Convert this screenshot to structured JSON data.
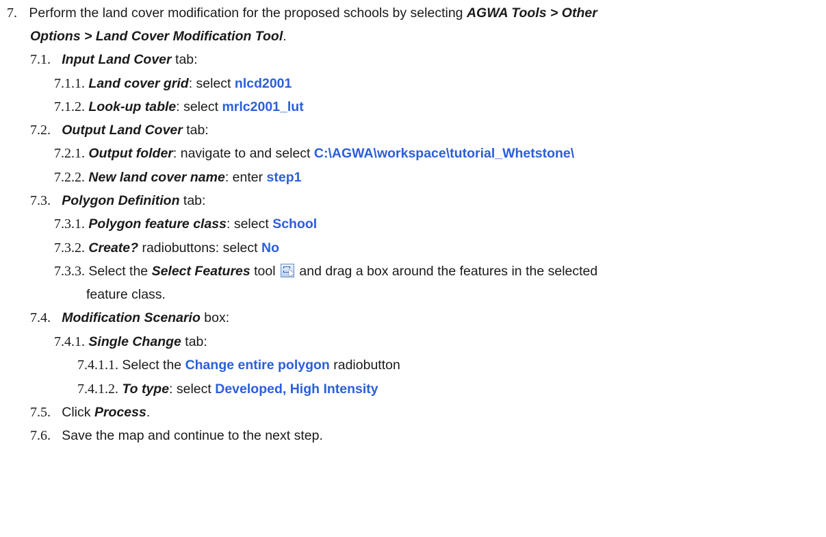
{
  "step7": {
    "num": "7.",
    "pre": "Perform the land cover modification for the proposed schools by selecting ",
    "path_line1": "AGWA Tools > Other",
    "path_line2": "Options > Land Cover Modification Tool",
    "end": "."
  },
  "s71": {
    "num": "7.1.",
    "title": "Input Land Cover",
    "suffix": " tab:"
  },
  "s711": {
    "num": "7.1.1.",
    "label": "Land cover grid",
    "sep": ": select ",
    "value": "nlcd2001"
  },
  "s712": {
    "num": "7.1.2.",
    "label": "Look-up table",
    "sep": ": select ",
    "value": "mrlc2001_lut"
  },
  "s72": {
    "num": "7.2.",
    "title": "Output Land Cover",
    "suffix": " tab:"
  },
  "s721": {
    "num": "7.2.1.",
    "label": "Output folder",
    "sep": ": navigate to and select ",
    "value": "C:\\AGWA\\workspace\\tutorial_Whetstone\\"
  },
  "s722": {
    "num": "7.2.2.",
    "label": "New land cover name",
    "sep": ": enter ",
    "value": "step1"
  },
  "s73": {
    "num": "7.3.",
    "title": "Polygon Definition",
    "suffix": " tab:"
  },
  "s731": {
    "num": "7.3.1.",
    "label": "Polygon feature class",
    "sep": ": select ",
    "value": "School"
  },
  "s732": {
    "num": "7.3.2.",
    "label": "Create?",
    "sep": " radiobuttons: select ",
    "value": "No"
  },
  "s733": {
    "num": "7.3.3.",
    "pre": "Select the ",
    "tool": "Select Features",
    "mid": " tool",
    "icon": "select-features-icon",
    "post": " and drag a box around the features in the selected",
    "line2": "feature class."
  },
  "s74": {
    "num": "7.4.",
    "title": "Modification Scenario",
    "suffix": " box:"
  },
  "s741": {
    "num": "7.4.1.",
    "title": "Single Change",
    "suffix": " tab:"
  },
  "s7411": {
    "num": "7.4.1.1.",
    "pre": "Select the ",
    "value": "Change entire polygon",
    "post": " radiobutton"
  },
  "s7412": {
    "num": "7.4.1.2.",
    "label": "To type",
    "sep": ": select ",
    "value": "Developed, High Intensity"
  },
  "s75": {
    "num": "7.5.",
    "pre": "Click ",
    "action": "Process",
    "end": "."
  },
  "s76": {
    "num": "7.6.",
    "text": "Save the map and continue to the next step."
  },
  "colors": {
    "text": "#1a1a1a",
    "value": "#2b5fd9"
  }
}
